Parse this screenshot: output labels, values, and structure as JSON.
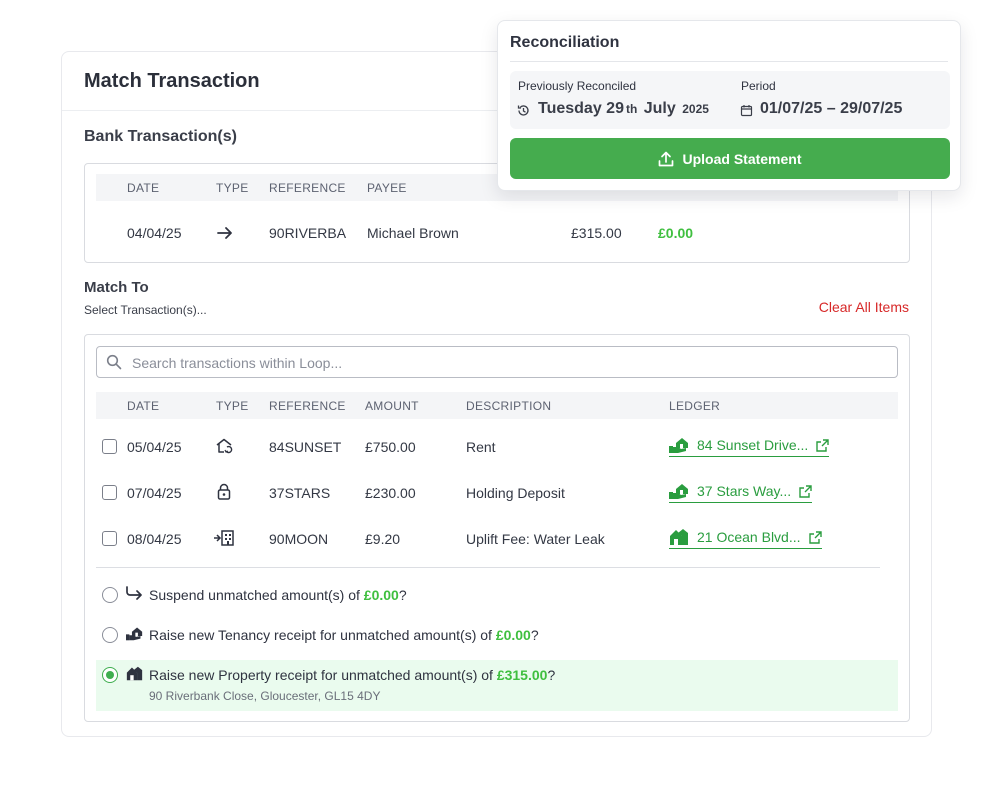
{
  "card": {
    "title": "Match Transaction",
    "bank_section_title": "Bank Transaction(s)",
    "bank_table": {
      "headers": [
        "DATE",
        "TYPE",
        "REFERENCE",
        "PAYEE"
      ],
      "row": {
        "date": "04/04/25",
        "type_icon": "arrow-right-icon",
        "reference": "90RIVERBA",
        "payee": "Michael Brown",
        "amount": "£315.00",
        "unmatched": "£0.00"
      }
    },
    "match_title": "Match To",
    "match_sub": "Select Transaction(s)...",
    "clear_all": "Clear All Items",
    "search_placeholder": "Search transactions within Loop...",
    "match_table": {
      "headers": [
        "DATE",
        "TYPE",
        "REFERENCE",
        "AMOUNT",
        "DESCRIPTION",
        "LEDGER"
      ],
      "rows": [
        {
          "date": "05/04/25",
          "type_icon": "house-cycle-icon",
          "reference": "84SUNSET",
          "amount": "£750.00",
          "description": "Rent",
          "ledger": "84 Sunset Drive..."
        },
        {
          "date": "07/04/25",
          "type_icon": "lock-icon",
          "reference": "37STARS",
          "amount": "£230.00",
          "description": "Holding Deposit",
          "ledger": "37 Stars Way..."
        },
        {
          "date": "08/04/25",
          "type_icon": "building-in-icon",
          "reference": "90MOON",
          "amount": "£9.20",
          "description": "Uplift Fee: Water Leak",
          "ledger": "21 Ocean Blvd..."
        }
      ]
    },
    "options": [
      {
        "prefix": "Suspend unmatched amount(s) of ",
        "amount": "£0.00",
        "suffix": "?",
        "icon": "forward-arrow-icon",
        "selected": false
      },
      {
        "prefix": "Raise new Tenancy receipt for unmatched amount(s) of ",
        "amount": "£0.00",
        "suffix": "?",
        "icon": "tenancy-hand-icon",
        "selected": false
      },
      {
        "prefix": "Raise new Property receipt for unmatched amount(s) of ",
        "amount": "£315.00",
        "suffix": "?",
        "icon": "property-icon",
        "selected": true,
        "address": "90 Riverbank Close, Gloucester, GL15 4DY"
      }
    ]
  },
  "recon": {
    "title": "Reconciliation",
    "prev_label": "Previously Reconciled",
    "prev_day": "Tuesday 29",
    "prev_suffix": "th",
    "prev_month": "July",
    "prev_year": "2025",
    "period_label": "Period",
    "period_value": "01/07/25 – 29/07/25",
    "upload_label": "Upload Statement"
  },
  "colors": {
    "accent_green": "#45ac4e",
    "link_green": "#2a9d3f",
    "danger_red": "#d72828"
  }
}
